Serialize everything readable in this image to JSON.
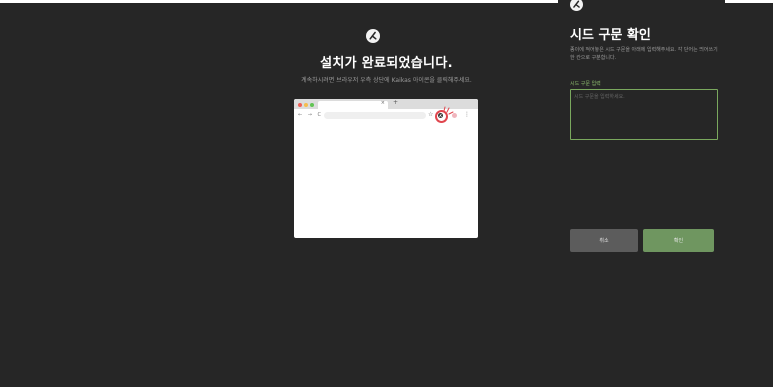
{
  "main": {
    "title": "설치가 완료되었습니다.",
    "subtitle": "계속하시려면 브라우저 우측 상단에 Kaikas 아이콘을 클릭해주세요.",
    "browser": {
      "tab_close": "×",
      "new_tab": "+",
      "nav": "← → C",
      "star": "☆",
      "menu": "⋮"
    }
  },
  "panel": {
    "title": "시드 구문 확인",
    "description": "종이에 적어놓은 시드 구문을 아래에 입력해주세요. 각 단어는 띄어쓰기 한 칸으로 구분합니다.",
    "input_label": "시드 구문 입력",
    "input_placeholder": "시드 구문을 입력하세요.",
    "input_value": "",
    "cancel_label": "취소",
    "confirm_label": "확인"
  },
  "colors": {
    "background": "#262626",
    "accent_green": "#6f9660",
    "input_border": "#7aa85e",
    "highlight_red": "#e0464e"
  },
  "icons": [
    "kaikas-logo-icon",
    "close-icon",
    "plus-icon",
    "star-icon",
    "menu-icon"
  ]
}
